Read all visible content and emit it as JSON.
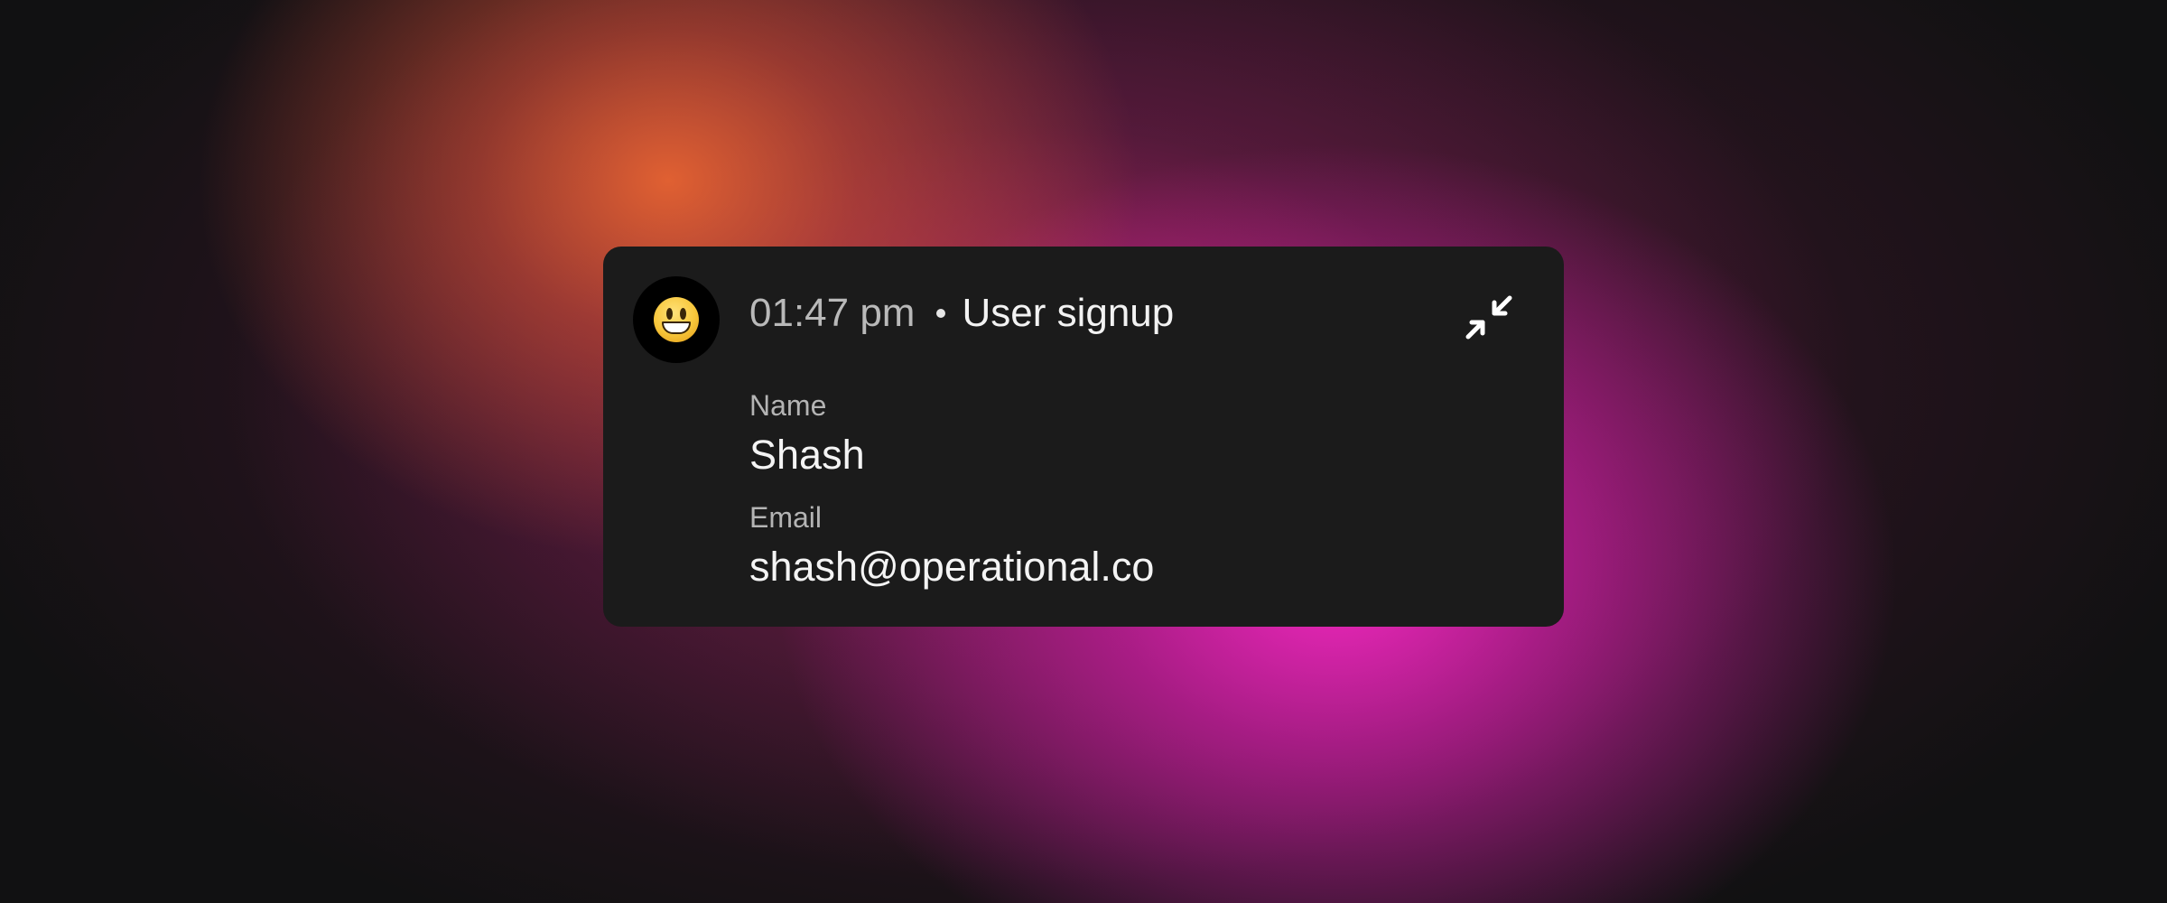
{
  "background": {
    "base_color": "#111112",
    "glow_colors": [
      "#e86432",
      "#f028be",
      "#be286e"
    ]
  },
  "notification": {
    "avatar_icon": "grinning-face-emoji",
    "time": "01:47 pm",
    "separator": "•",
    "event": "User signup",
    "collapse_icon": "collapse-arrows-icon",
    "card_color": "#1b1b1b",
    "fields": [
      {
        "label": "Name",
        "value": "Shash"
      },
      {
        "label": "Email",
        "value": "shash@operational.co"
      }
    ]
  }
}
